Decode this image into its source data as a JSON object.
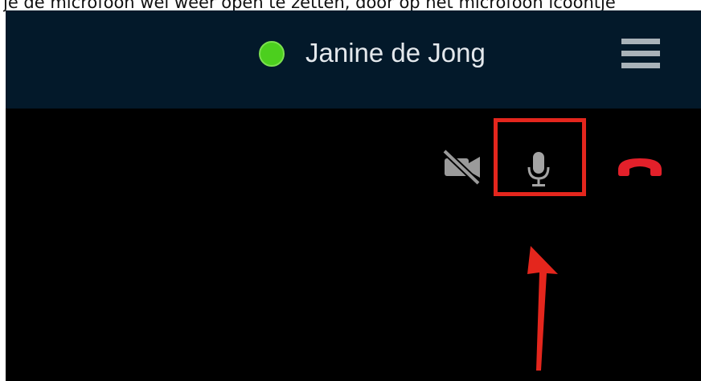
{
  "caption": {
    "text": "je de microfoon wel weer open te zetten, door op het microfoon icoontje"
  },
  "header": {
    "contact_name": "Janine de Jong",
    "presence_status_color": "#4ccf1e",
    "menu_icon": "hamburger-menu-icon",
    "background_color": "#03192a"
  },
  "call_controls": {
    "camera": {
      "icon": "camera-off-icon",
      "state": "off"
    },
    "microphone": {
      "icon": "microphone-icon",
      "highlighted": true
    },
    "hangup": {
      "icon": "phone-hangup-icon",
      "color": "#e3202a"
    }
  },
  "annotation": {
    "highlight_color": "#e4261d",
    "arrow_icon": "arrow-up-icon"
  }
}
